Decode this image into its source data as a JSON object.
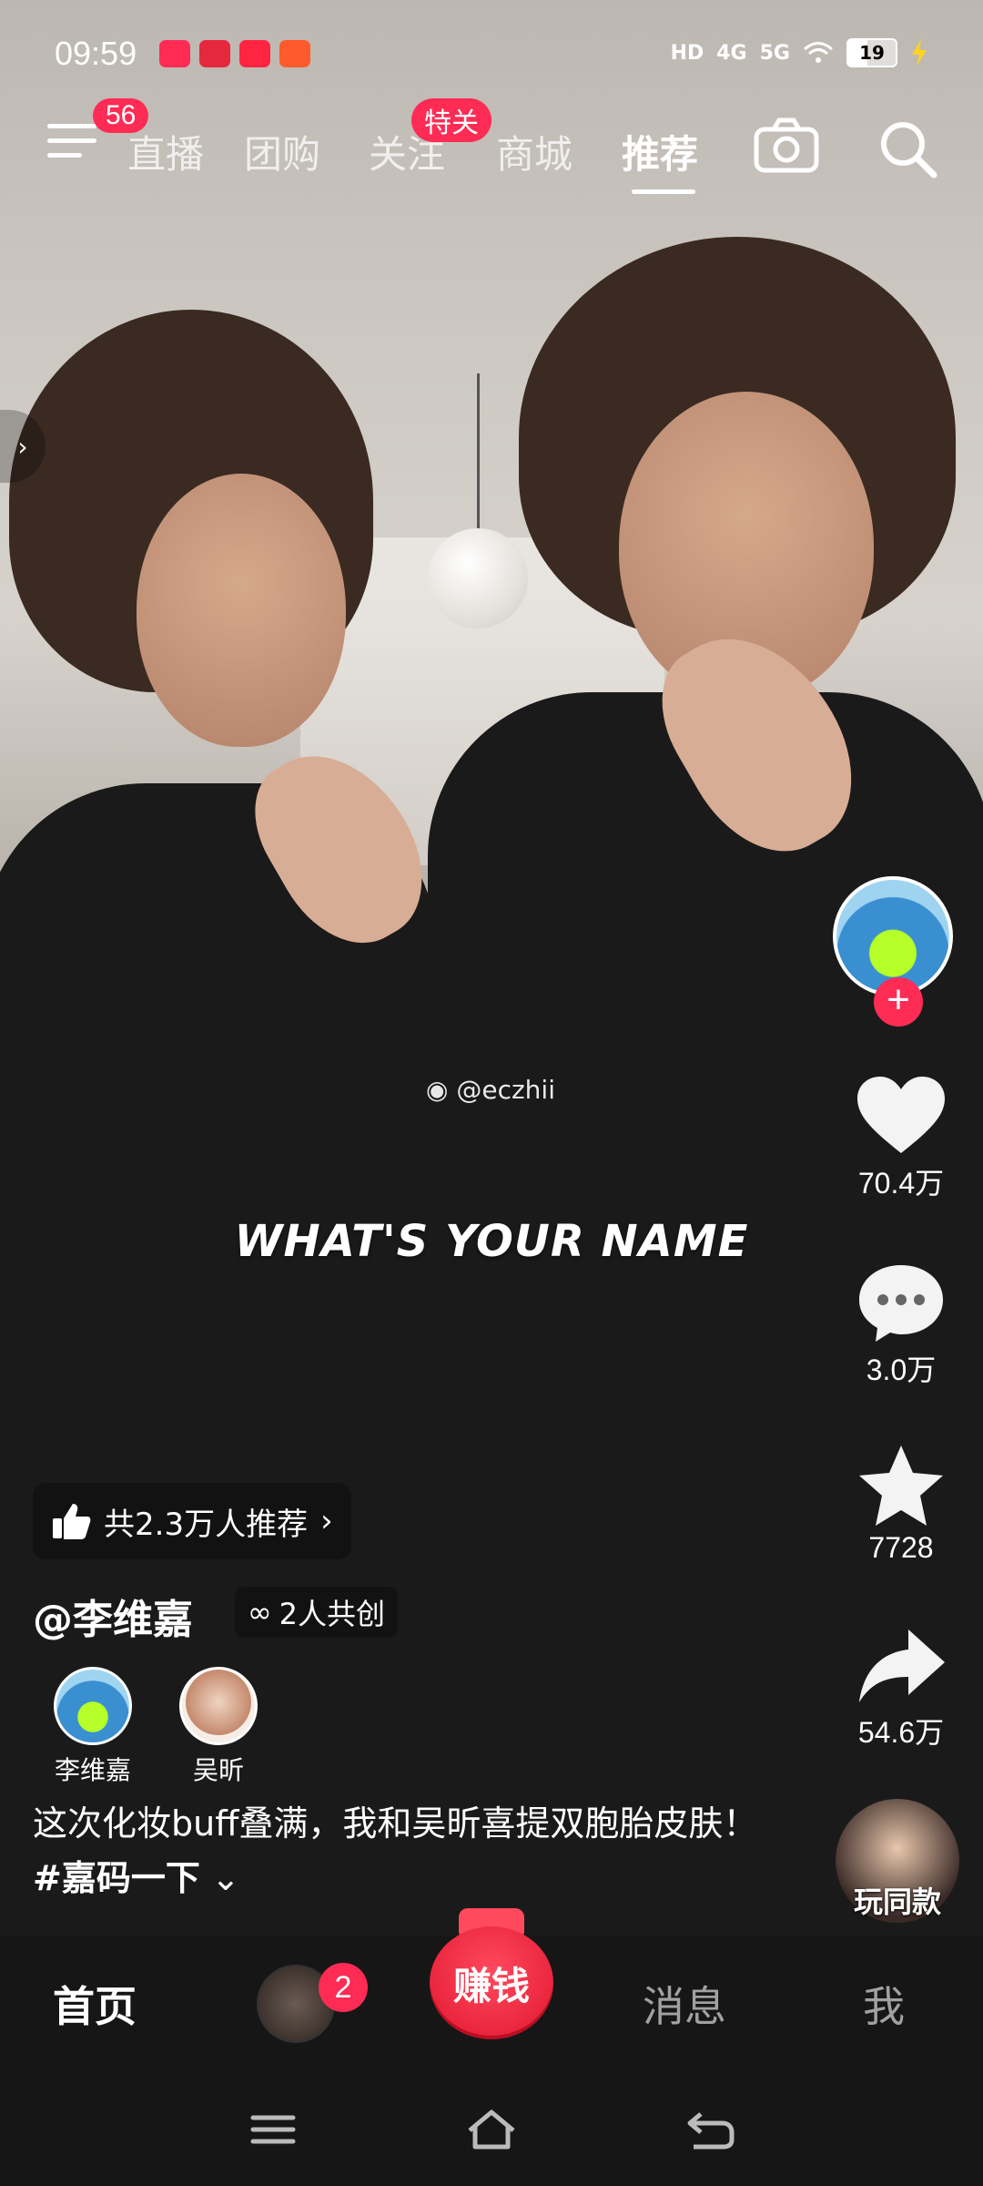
{
  "status_bar": {
    "time": "09:59",
    "hd": "HD",
    "net1": "4G",
    "net2": "5G",
    "battery": "19"
  },
  "top_nav": {
    "menu_badge": "56",
    "tabs": [
      "直播",
      "团购",
      "关注",
      "商城",
      "推荐"
    ],
    "follow_badge": "特关",
    "active_tab": "推荐"
  },
  "video": {
    "watermark": "@eczhii",
    "caption": "WHAT'S YOUR NAME"
  },
  "rail": {
    "likes": "70.4万",
    "comments": "3.0万",
    "favorites": "7728",
    "shares": "54.6万",
    "tongkuan": "玩同款"
  },
  "info": {
    "recommend": "共2.3万人推荐",
    "author": "@李维嘉",
    "cocreate": "2人共创",
    "creators": [
      "李维嘉",
      "吴昕"
    ],
    "desc_text": "这次化妆buff叠满，我和吴昕喜提双胞胎皮肤！",
    "desc_tag": "#嘉码一下"
  },
  "bottom_nav": {
    "home": "首页",
    "friend_badge": "2",
    "earn": "赚钱",
    "messages": "消息",
    "me": "我"
  },
  "colors": {
    "accent": "#fe2c55",
    "nav_bg": "#161616"
  }
}
